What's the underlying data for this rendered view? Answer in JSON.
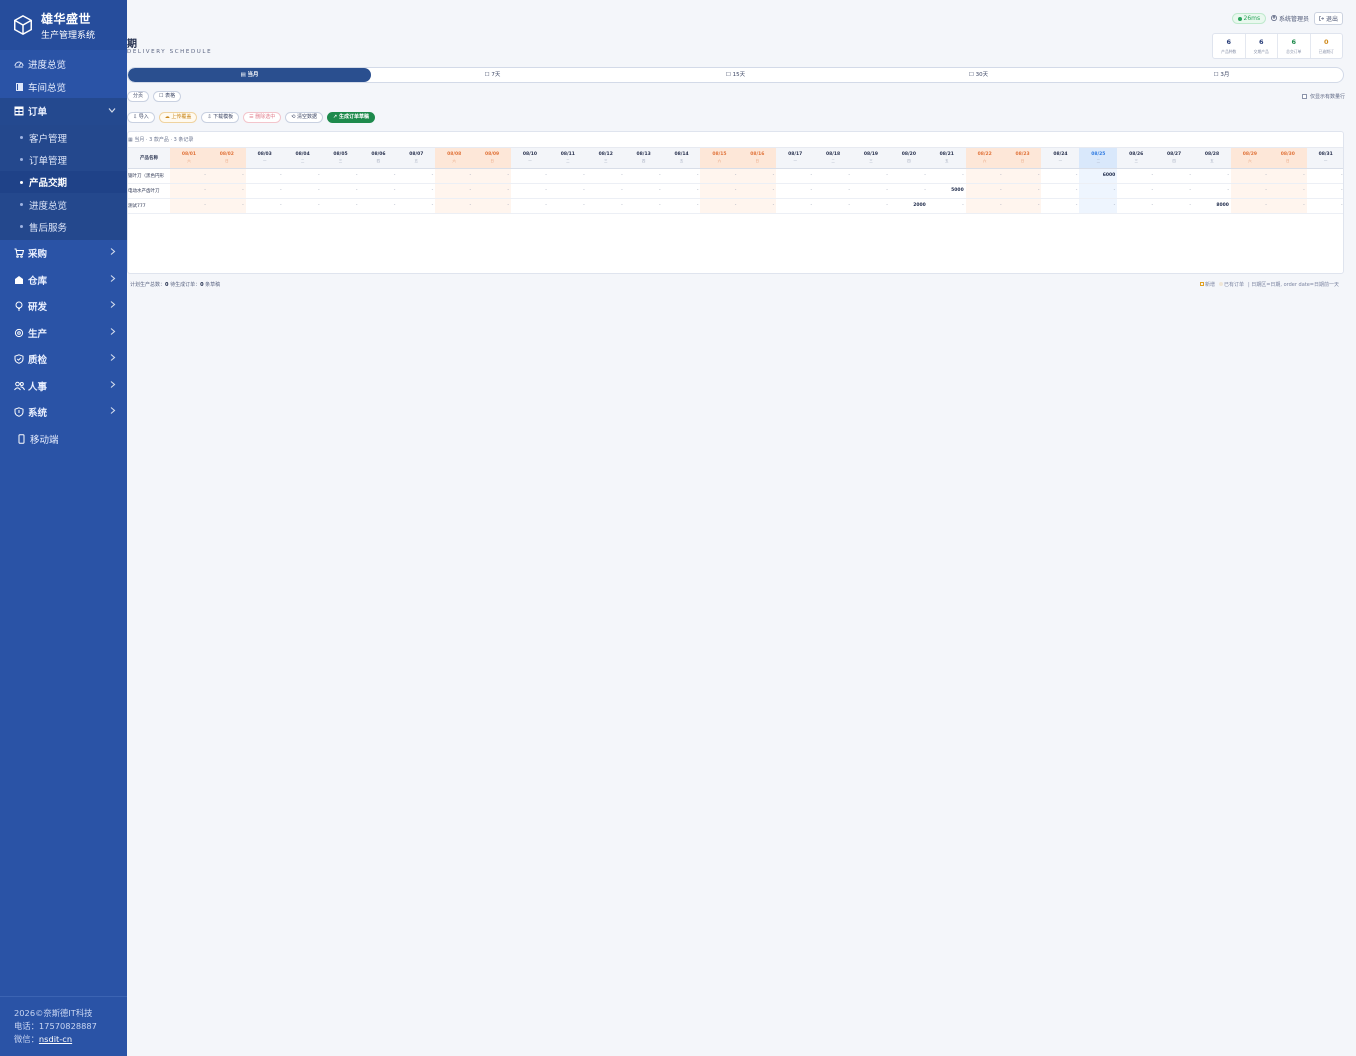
{
  "brand": {
    "name": "雄华盛世",
    "system": "生产管理系统"
  },
  "sidebar": {
    "top_items": [
      {
        "label": "进度总览",
        "icon": "dashboard-icon"
      },
      {
        "label": "车间总览",
        "icon": "book-icon"
      }
    ],
    "order_section": {
      "label": "订单",
      "icon": "table-icon"
    },
    "order_sub": [
      "客户管理",
      "订单管理",
      "产品交期",
      "进度总览",
      "售后服务"
    ],
    "sections": [
      {
        "label": "采购",
        "icon": "cart-icon"
      },
      {
        "label": "仓库",
        "icon": "warehouse-icon"
      },
      {
        "label": "研发",
        "icon": "bulb-icon"
      },
      {
        "label": "生产",
        "icon": "gear-icon"
      },
      {
        "label": "质检",
        "icon": "shield-check-icon"
      },
      {
        "label": "人事",
        "icon": "people-icon"
      },
      {
        "label": "系统",
        "icon": "shield-icon"
      }
    ],
    "mobile": {
      "label": "移动端",
      "icon": "mobile-icon"
    },
    "footer": {
      "copyright": "2026©奈斯德IT科技",
      "phone": "电话：17570828887",
      "wechat_label": "微信：",
      "wechat": "nsdit-cn"
    }
  },
  "topbar": {
    "ping": "26ms",
    "user": "系统管理员",
    "logout": "退出"
  },
  "page": {
    "title": "期",
    "subtitle": "DELIVERY SCHEDULE"
  },
  "stats": [
    {
      "n": "6",
      "l": "产品种数",
      "color": "#2a3f7a"
    },
    {
      "n": "6",
      "l": "交期产品",
      "color": "#2a3f7a"
    },
    {
      "n": "6",
      "l": "总交订单",
      "color": "#1e8a4c"
    },
    {
      "n": "0",
      "l": "已逾期订",
      "color": "#d08a1a"
    }
  ],
  "ranges": [
    "▤ 当月",
    "☐ 7天",
    "☐ 15天",
    "☐ 30天",
    "☐ 3月"
  ],
  "view_toggles": [
    "分页",
    "☐ 表格"
  ],
  "only_show": "仅显示有数量行",
  "toolbar": [
    {
      "label": "⇩ 导入",
      "kind": ""
    },
    {
      "label": "☁ 上传覆盖",
      "kind": "warn"
    },
    {
      "label": "⇩ 下载模板",
      "kind": ""
    },
    {
      "label": "☰ 删除选中",
      "kind": "danger"
    },
    {
      "label": "⟲ 清空数据",
      "kind": ""
    },
    {
      "label": "↗ 生成订单草稿",
      "kind": "primary"
    }
  ],
  "table": {
    "info": "▦ 当月 · 3 款产品 · 3 条记录",
    "product_header": "产品名称",
    "days": [
      {
        "d": "08/01",
        "w": "六",
        "t": "weekend"
      },
      {
        "d": "08/02",
        "w": "日",
        "t": "weekend"
      },
      {
        "d": "08/03",
        "w": "一",
        "t": ""
      },
      {
        "d": "08/04",
        "w": "二",
        "t": ""
      },
      {
        "d": "08/05",
        "w": "三",
        "t": ""
      },
      {
        "d": "08/06",
        "w": "四",
        "t": ""
      },
      {
        "d": "08/07",
        "w": "五",
        "t": ""
      },
      {
        "d": "08/08",
        "w": "六",
        "t": "weekend"
      },
      {
        "d": "08/09",
        "w": "日",
        "t": "weekend"
      },
      {
        "d": "08/10",
        "w": "一",
        "t": ""
      },
      {
        "d": "08/11",
        "w": "二",
        "t": ""
      },
      {
        "d": "08/12",
        "w": "三",
        "t": ""
      },
      {
        "d": "08/13",
        "w": "四",
        "t": ""
      },
      {
        "d": "08/14",
        "w": "五",
        "t": ""
      },
      {
        "d": "08/15",
        "w": "六",
        "t": "weekend"
      },
      {
        "d": "08/16",
        "w": "日",
        "t": "weekend"
      },
      {
        "d": "08/17",
        "w": "一",
        "t": ""
      },
      {
        "d": "08/18",
        "w": "二",
        "t": ""
      },
      {
        "d": "08/19",
        "w": "三",
        "t": ""
      },
      {
        "d": "08/20",
        "w": "四",
        "t": ""
      },
      {
        "d": "08/21",
        "w": "五",
        "t": ""
      },
      {
        "d": "08/22",
        "w": "六",
        "t": "weekend"
      },
      {
        "d": "08/23",
        "w": "日",
        "t": "weekend"
      },
      {
        "d": "08/24",
        "w": "一",
        "t": ""
      },
      {
        "d": "08/25",
        "w": "二",
        "t": "today"
      },
      {
        "d": "08/26",
        "w": "三",
        "t": ""
      },
      {
        "d": "08/27",
        "w": "四",
        "t": ""
      },
      {
        "d": "08/28",
        "w": "五",
        "t": ""
      },
      {
        "d": "08/29",
        "w": "六",
        "t": "weekend"
      },
      {
        "d": "08/30",
        "w": "日",
        "t": "weekend"
      },
      {
        "d": "08/31",
        "w": "一",
        "t": ""
      }
    ],
    "rows": [
      {
        "name": "锯叶刀（黑色円形",
        "values": [
          "-",
          "-",
          "-",
          "-",
          "-",
          "-",
          "-",
          "-",
          "-",
          "-",
          "-",
          "-",
          "-",
          "-",
          "-",
          "-",
          "-",
          "-",
          "-",
          "-",
          "-",
          "-",
          "-",
          "-",
          "6000",
          "-",
          "-",
          "-",
          "-",
          "-",
          "-"
        ]
      },
      {
        "name": "电动水产齿叶刀",
        "values": [
          "-",
          "-",
          "-",
          "-",
          "-",
          "-",
          "-",
          "-",
          "-",
          "-",
          "-",
          "-",
          "-",
          "-",
          "-",
          "-",
          "-",
          "-",
          "-",
          "-",
          "5000",
          "-",
          "-",
          "-",
          "-",
          "-",
          "-",
          "-",
          "-",
          "-",
          "-"
        ]
      },
      {
        "name": "测试777",
        "values": [
          "-",
          "-",
          "-",
          "-",
          "-",
          "-",
          "-",
          "-",
          "-",
          "-",
          "-",
          "-",
          "-",
          "-",
          "-",
          "-",
          "-",
          "-",
          "-",
          "2000",
          "-",
          "-",
          "-",
          "-",
          "-",
          "-",
          "-",
          "8000",
          "-",
          "-",
          "-"
        ]
      }
    ]
  },
  "summary": {
    "l1": "计划生产总数：",
    "v1": "0",
    "l2": "   待生成订单：",
    "v2": "0",
    "l3": " 条草稿"
  },
  "legend": {
    "a": "新增",
    "b": "已有订单",
    "c": "| 日期区=日期, order date=日期前一天"
  }
}
